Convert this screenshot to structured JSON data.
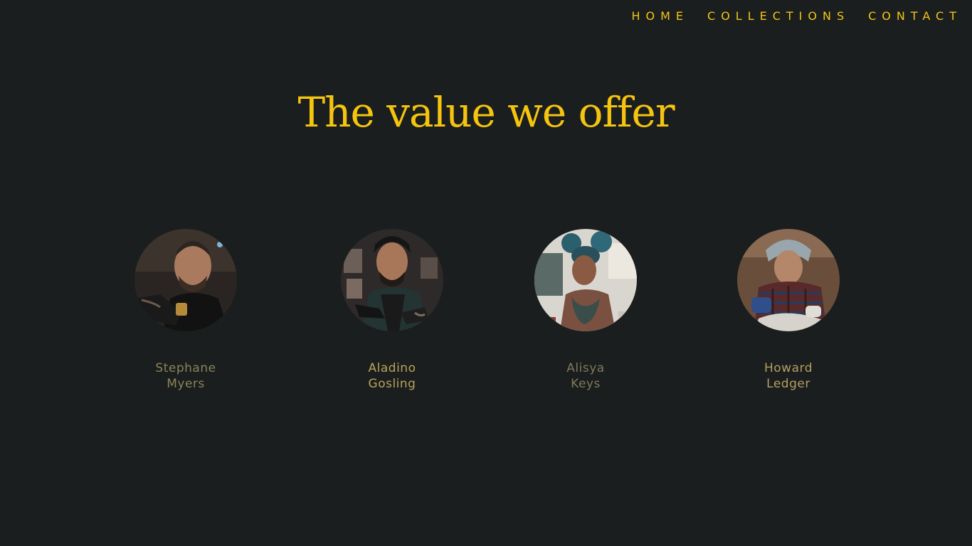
{
  "nav": {
    "items": [
      {
        "label": "HOME"
      },
      {
        "label": "COLLECTIONS"
      },
      {
        "label": "CONTACT"
      }
    ],
    "color": "#f2c614"
  },
  "hero": {
    "title": "The value we offer",
    "color": "#f5c40f"
  },
  "team": {
    "members": [
      {
        "first": "Stephane",
        "last": "Myers",
        "photo": "tattoo-artist-photo",
        "name_color": "#8a8558"
      },
      {
        "first": "Aladino",
        "last": "Gosling",
        "photo": "tattoo-artist-photo",
        "name_color": "#b8a25c"
      },
      {
        "first": "Alisya",
        "last": "Keys",
        "photo": "tattoo-artist-photo",
        "name_color": "#7e7b58"
      },
      {
        "first": "Howard",
        "last": "Ledger",
        "photo": "tattoo-artist-photo",
        "name_color": "#b59f62"
      }
    ]
  },
  "colors": {
    "background": "#1b1e1e"
  }
}
